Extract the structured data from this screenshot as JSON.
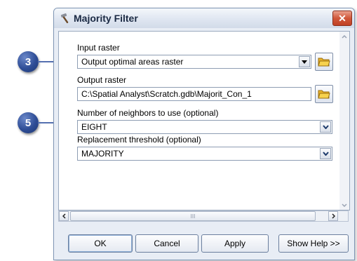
{
  "callouts": [
    {
      "number": "3"
    },
    {
      "number": "5"
    }
  ],
  "dialog": {
    "title": "Majority Filter",
    "close_label": "✕",
    "fields": {
      "input_raster": {
        "label": "Input raster",
        "value": "Output optimal areas raster"
      },
      "output_raster": {
        "label": "Output raster",
        "value": "C:\\Spatial  Analyst\\Scratch.gdb\\Majorit_Con_1"
      },
      "neighbors": {
        "label": "Number of neighbors to use (optional)",
        "value": "EIGHT"
      },
      "replacement": {
        "label": "Replacement threshold (optional)",
        "value": "MAJORITY"
      }
    },
    "buttons": {
      "ok": "OK",
      "cancel": "Cancel",
      "apply": "Apply",
      "show_help": "Show Help >>"
    },
    "hscroll_grip": "III"
  },
  "colors": {
    "accent": "#2e4d96",
    "close": "#d0573a",
    "folder": "#f0c030"
  }
}
